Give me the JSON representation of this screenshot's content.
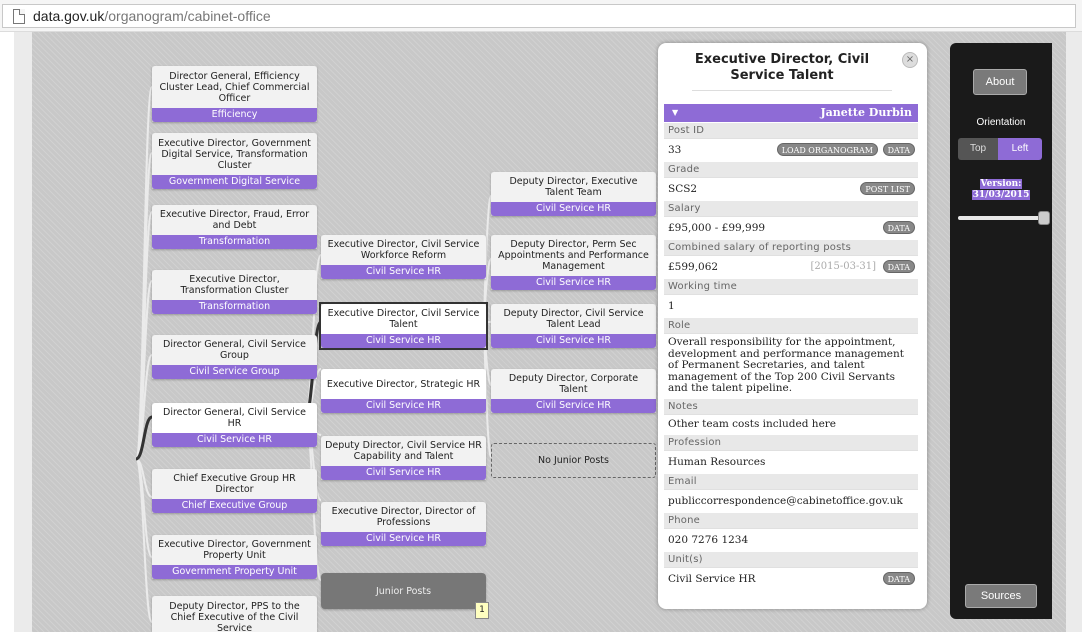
{
  "browser": {
    "url_host": "data.gov.uk",
    "url_path": "/organogram/cabinet-office"
  },
  "tree": {
    "column1": [
      {
        "title": "Director General, Efficiency Cluster Lead, Chief Commercial Officer",
        "dept": "Efficiency"
      },
      {
        "title": "Executive Director, Government Digital Service, Transformation Cluster",
        "dept": "Government Digital Service"
      },
      {
        "title": "Executive Director, Fraud, Error and Debt",
        "dept": "Transformation"
      },
      {
        "title": "Executive Director, Transformation Cluster",
        "dept": "Transformation"
      },
      {
        "title": "Director General, Civil Service Group",
        "dept": "Civil Service Group"
      },
      {
        "title": "Director General, Civil Service HR",
        "dept": "Civil Service HR"
      },
      {
        "title": "Chief Executive Group HR Director",
        "dept": "Chief Executive Group"
      },
      {
        "title": "Executive Director, Government Property Unit",
        "dept": "Government Property Unit"
      },
      {
        "title": "Deputy Director, PPS to the Chief Executive of the Civil Service",
        "dept": ""
      }
    ],
    "column2": [
      {
        "title": "Executive Director, Civil Service Workforce Reform",
        "dept": "Civil Service HR"
      },
      {
        "title": "Executive Director, Civil Service Talent",
        "dept": "Civil Service HR"
      },
      {
        "title": "Executive Director, Strategic HR",
        "dept": "Civil Service HR"
      },
      {
        "title": "Deputy Director, Civil Service HR Capability and Talent",
        "dept": "Civil Service HR"
      },
      {
        "title": "Executive Director, Director of Professions",
        "dept": "Civil Service HR"
      },
      {
        "title": "Junior Posts",
        "dept": ""
      }
    ],
    "column3": [
      {
        "title": "Deputy Director, Executive Talent Team",
        "dept": "Civil Service HR"
      },
      {
        "title": "Deputy Director, Perm Sec Appointments and Performance Management",
        "dept": "Civil Service HR"
      },
      {
        "title": "Deputy Director, Civil Service Talent Lead",
        "dept": "Civil Service HR"
      },
      {
        "title": "Deputy Director, Corporate Talent",
        "dept": "Civil Service HR"
      },
      {
        "title": "No Junior Posts",
        "dept": ""
      }
    ],
    "junior_badge": "1"
  },
  "panel": {
    "title": "Executive Director, Civil Service Talent",
    "close": "×",
    "person": "Janette Durbin",
    "caret": "▼",
    "labels": {
      "post_id": "Post ID",
      "grade": "Grade",
      "salary": "Salary",
      "combined": "Combined salary of reporting posts",
      "working_time": "Working time",
      "role": "Role",
      "notes": "Notes",
      "profession": "Profession",
      "email": "Email",
      "phone": "Phone",
      "units": "Unit(s)"
    },
    "values": {
      "post_id": "33",
      "grade": "SCS2",
      "salary": "£95,000 - £99,999",
      "combined": "£599,062",
      "combined_date": "[2015-03-31]",
      "working_time": "1",
      "role": "Overall responsibility for the appointment, development and performance management of Permanent Secretaries, and talent management of the Top 200 Civil Servants and the talent pipeline.",
      "notes": "Other team costs included here",
      "profession": "Human Resources",
      "email": "publiccorrespondence@cabinetoffice.gov.uk",
      "phone": "020 7276 1234",
      "units": "Civil Service HR"
    },
    "buttons": {
      "load_organogram": "LOAD ORGANOGRAM",
      "data": "DATA",
      "post_list": "POST LIST"
    }
  },
  "sidebar": {
    "about": "About",
    "orientation": "Orientation",
    "top": "Top",
    "left": "Left",
    "version_label": "Version:",
    "version_date": "31/03/2015",
    "slider_position": 1.0,
    "sources": "Sources"
  },
  "colors": {
    "accent": "#8e6bd6",
    "sidebar_bg": "#1a1a1a"
  }
}
